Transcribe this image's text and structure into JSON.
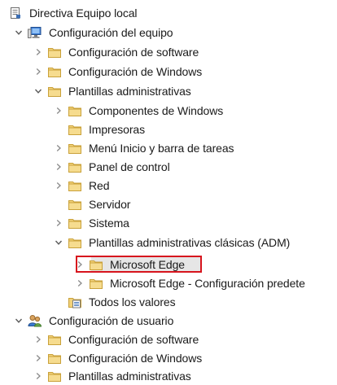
{
  "tree": {
    "root": {
      "label": "Directiva Equipo local",
      "icon": "policy-document-icon"
    },
    "computer_config": {
      "label": "Configuración del equipo",
      "icon": "computer-icon"
    },
    "cc_software": {
      "label": "Configuración de software",
      "icon": "folder-icon"
    },
    "cc_windows": {
      "label": "Configuración de Windows",
      "icon": "folder-icon"
    },
    "cc_admin": {
      "label": "Plantillas administrativas",
      "icon": "folder-icon"
    },
    "cc_admin_components": {
      "label": "Componentes de Windows",
      "icon": "folder-icon"
    },
    "cc_admin_printers": {
      "label": "Impresoras",
      "icon": "folder-icon"
    },
    "cc_admin_start": {
      "label": "Menú Inicio y barra de tareas",
      "icon": "folder-icon"
    },
    "cc_admin_control": {
      "label": "Panel de control",
      "icon": "folder-icon"
    },
    "cc_admin_network": {
      "label": "Red",
      "icon": "folder-icon"
    },
    "cc_admin_server": {
      "label": "Servidor",
      "icon": "folder-icon"
    },
    "cc_admin_system": {
      "label": "Sistema",
      "icon": "folder-icon"
    },
    "cc_admin_classic": {
      "label": "Plantillas administrativas clásicas (ADM)",
      "icon": "folder-icon"
    },
    "cc_admin_classic_edge": {
      "label": "Microsoft Edge",
      "icon": "folder-icon"
    },
    "cc_admin_classic_edge_defaults": {
      "label": "Microsoft Edge - Configuración predete",
      "icon": "folder-icon"
    },
    "cc_admin_all": {
      "label": "Todos los valores",
      "icon": "settings-list-icon"
    },
    "user_config": {
      "label": "Configuración de usuario",
      "icon": "users-icon"
    },
    "uc_software": {
      "label": "Configuración de software",
      "icon": "folder-icon"
    },
    "uc_windows": {
      "label": "Configuración de Windows",
      "icon": "folder-icon"
    },
    "uc_admin": {
      "label": "Plantillas administrativas",
      "icon": "folder-icon"
    }
  },
  "colors": {
    "highlight_border": "#d7141d",
    "folder_fill": "#f2d27a",
    "folder_stroke": "#c9a13a",
    "chevron": "#5a5a5a",
    "selection_bg": "#e6e6e6"
  }
}
